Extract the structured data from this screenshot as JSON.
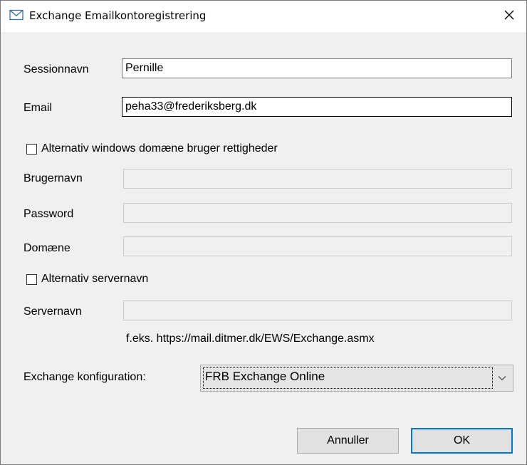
{
  "window": {
    "title": "Exchange Emailkontoregistrering"
  },
  "fields": {
    "session_label": "Sessionnavn",
    "session_value": "Pernille",
    "email_label": "Email",
    "email_value": "peha33@frederiksberg.dk",
    "alt_windows_checkbox_label": "Alternativ windows domæne bruger rettigheder",
    "alt_windows_checked": false,
    "username_label": "Brugernavn",
    "username_value": "",
    "password_label": "Password",
    "password_value": "",
    "domain_label": "Domæne",
    "domain_value": "",
    "alt_server_checkbox_label": "Alternativ servernavn",
    "alt_server_checked": false,
    "servername_label": "Servernavn",
    "servername_value": "",
    "servername_hint": "f.eks. https://mail.ditmer.dk/EWS/Exchange.asmx",
    "config_label": "Exchange konfiguration:",
    "config_selected": "FRB Exchange Online"
  },
  "buttons": {
    "cancel": "Annuller",
    "ok": "OK"
  },
  "icons": {
    "title": "mail-envelope-icon",
    "close": "close-icon",
    "dropdown": "chevron-down-icon"
  },
  "colors": {
    "default_button_border": "#0078d7",
    "dialog_background": "#f0f0f0"
  }
}
